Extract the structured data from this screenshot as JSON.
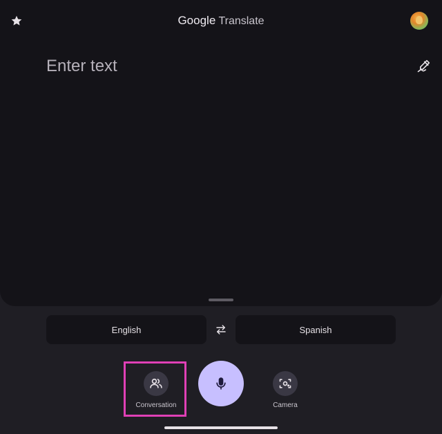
{
  "header": {
    "brand": "Google",
    "product": "Translate",
    "favorites_icon": "star-icon",
    "account_icon": "avatar"
  },
  "input": {
    "placeholder": "Enter text",
    "handwriting_icon": "handwriting-icon"
  },
  "languages": {
    "source": "English",
    "target": "Spanish",
    "swap_icon": "swap-icon"
  },
  "actions": {
    "conversation_label": "Conversation",
    "conversation_icon": "people-icon",
    "mic_icon": "mic-icon",
    "camera_label": "Camera",
    "camera_icon": "camera-icon"
  },
  "colors": {
    "background": "#1f1e24",
    "panel": "#141318",
    "mic_accent": "#c7bfff",
    "highlight": "#e040b6"
  }
}
